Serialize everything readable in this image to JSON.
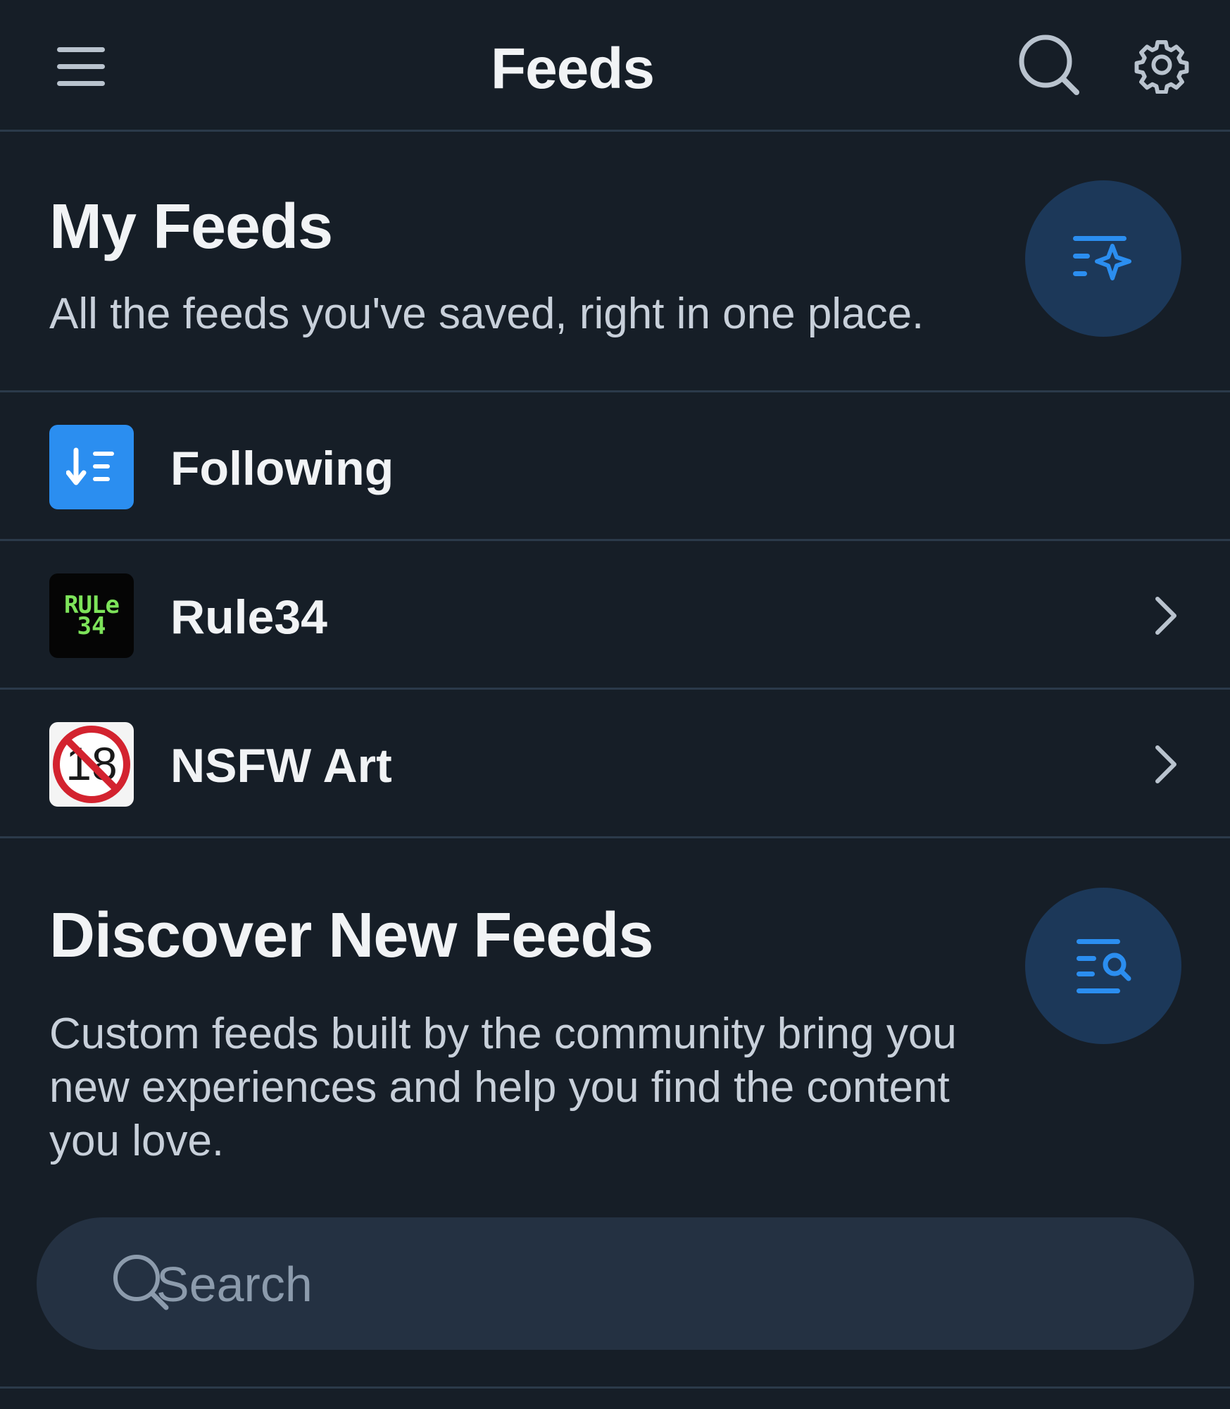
{
  "header": {
    "title": "Feeds",
    "icons": [
      "menu-icon",
      "search-icon",
      "gear-icon"
    ]
  },
  "my_feeds": {
    "title": "My Feeds",
    "description": "All the feeds you've saved, right in one place.",
    "action_icon": "list-sparkle-icon"
  },
  "feeds": [
    {
      "name": "Following",
      "avatar": "following-sort-icon",
      "has_chevron": false
    },
    {
      "name": "Rule34",
      "avatar_text_line1": "RULe",
      "avatar_text_line2": "34",
      "has_chevron": true
    },
    {
      "name": "NSFW Art",
      "avatar_text": "18",
      "has_chevron": true
    }
  ],
  "discover": {
    "title": "Discover New Feeds",
    "description": "Custom feeds built by the community bring you new experiences and help you find the content you love.",
    "action_icon": "list-search-icon"
  },
  "search": {
    "placeholder": "Search"
  },
  "colors": {
    "background": "#161e27",
    "divider": "#2b3a4a",
    "accent": "#2b8ef0",
    "circle_button": "#1c3859",
    "search_bg": "#243142",
    "rule34_green": "#7de35a"
  }
}
